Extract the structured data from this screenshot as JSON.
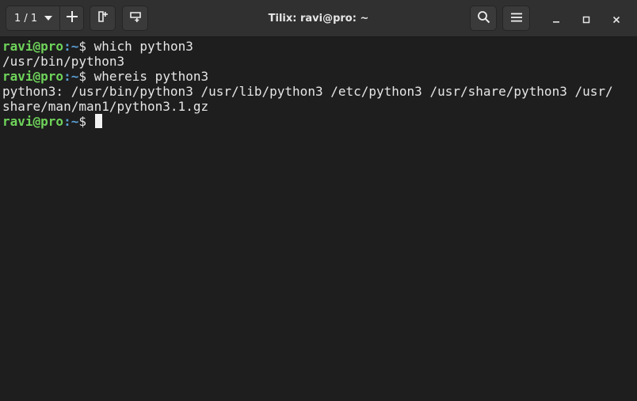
{
  "window": {
    "title": "Tilix: ravi@pro: ~"
  },
  "toolbar": {
    "session_indicator": "1 / 1",
    "icons": {
      "session_menu": "chevron-down-icon",
      "add_session": "plus-icon",
      "add_terminal_right": "split-right-icon",
      "add_terminal_down": "split-down-icon",
      "search": "search-icon",
      "menu": "hamburger-menu-icon",
      "minimize": "minimize-icon",
      "maximize": "maximize-icon",
      "close": "close-icon"
    }
  },
  "terminal": {
    "colors": {
      "background": "#1e1e1e",
      "text": "#e6e6e6",
      "user_host": "#6ed35a",
      "path": "#5a9fd4"
    },
    "prompt": {
      "user_host": "ravi@pro",
      "separator": ":",
      "path": "~",
      "symbol": "$"
    },
    "lines": [
      {
        "type": "command",
        "command": " which python3"
      },
      {
        "type": "output",
        "text": "/usr/bin/python3"
      },
      {
        "type": "command",
        "command": " whereis python3"
      },
      {
        "type": "output",
        "text": "python3: /usr/bin/python3 /usr/lib/python3 /etc/python3 /usr/share/python3 /usr/"
      },
      {
        "type": "output",
        "text": "share/man/man1/python3.1.gz"
      },
      {
        "type": "command",
        "command": " "
      }
    ]
  }
}
